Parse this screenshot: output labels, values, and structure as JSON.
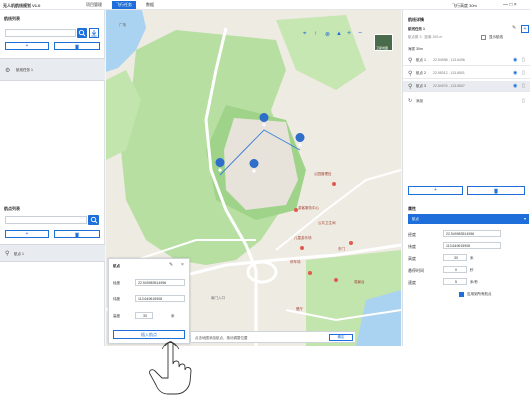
{
  "titlebar": {
    "app_name": "无人机航线规划 V1.0",
    "tabs": [
      "项目管理",
      "飞行任务",
      "数据"
    ],
    "active_tab": 1,
    "right_info": "飞行高度 30m",
    "window_controls": "— □ ×"
  },
  "left_panel": {
    "route_title": "航线列表",
    "route_search_placeholder": "",
    "add_label": "+",
    "delete_label": "🗑",
    "route_item": "航线任务 1",
    "point_title": "航点列表",
    "point_add_label": "+",
    "point_item": "航点 1"
  },
  "map": {
    "basemap_label": "卫星地图",
    "toolbar_icons": [
      "locate-icon",
      "north-icon",
      "ruler-icon",
      "triangle-icon",
      "zoom-in-icon",
      "zoom-out-icon"
    ],
    "labels": [
      "公园管理处",
      "游客服务中心",
      "公共卫生间",
      "东门",
      "停车场",
      "儿童游乐场",
      "南门入口",
      "广场",
      "餐厅",
      "观景台"
    ]
  },
  "popup": {
    "title": "航点",
    "lng_label": "经度",
    "lng_value": "22.549983514956",
    "lat_label": "纬度",
    "lat_value": "113.649615908",
    "alt_label": "高度",
    "alt_value": "30",
    "alt_unit": "米",
    "confirm_label": "插入航点"
  },
  "bottom_tip": {
    "text": "点击地图添加航点，拖动调整位置",
    "button": "确定"
  },
  "right_panel": {
    "title": "航线详情",
    "route_name": "航线任务 1",
    "route_meta": "航点数 3 · 距离 263 m",
    "checkbox_label": "显示航线",
    "altitude_label": "海拔 30m",
    "waypoints": [
      {
        "name": "航点 1",
        "coords": "22.54998 , 113.6496"
      },
      {
        "name": "航点 2",
        "coords": "22.55012 , 113.6501"
      },
      {
        "name": "航点 3",
        "coords": "22.54976 , 113.6507"
      }
    ],
    "add_action": "添加",
    "props_title": "属性",
    "type_value": "航点",
    "props": [
      {
        "key": "经度",
        "value": "22.549983514956",
        "unit": ""
      },
      {
        "key": "纬度",
        "value": "113.649615908",
        "unit": ""
      },
      {
        "key": "高度",
        "value": "30",
        "unit": "米"
      },
      {
        "key": "悬停时间",
        "value": "0",
        "unit": "秒"
      },
      {
        "key": "速度",
        "value": "5",
        "unit": "米/秒"
      }
    ],
    "apply_all_label": "应用到所有航点"
  }
}
